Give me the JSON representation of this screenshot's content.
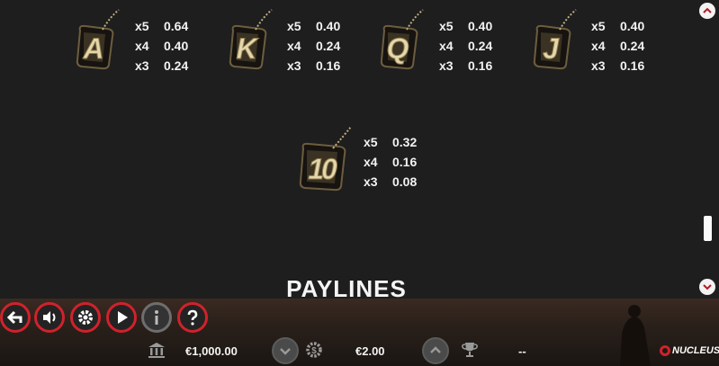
{
  "paytable": {
    "symbols": [
      {
        "letter": "A",
        "pays": [
          {
            "mult": "x5",
            "value": "0.64"
          },
          {
            "mult": "x4",
            "value": "0.40"
          },
          {
            "mult": "x3",
            "value": "0.24"
          }
        ]
      },
      {
        "letter": "K",
        "pays": [
          {
            "mult": "x5",
            "value": "0.40"
          },
          {
            "mult": "x4",
            "value": "0.24"
          },
          {
            "mult": "x3",
            "value": "0.16"
          }
        ]
      },
      {
        "letter": "Q",
        "pays": [
          {
            "mult": "x5",
            "value": "0.40"
          },
          {
            "mult": "x4",
            "value": "0.24"
          },
          {
            "mult": "x3",
            "value": "0.16"
          }
        ]
      },
      {
        "letter": "J",
        "pays": [
          {
            "mult": "x5",
            "value": "0.40"
          },
          {
            "mult": "x4",
            "value": "0.24"
          },
          {
            "mult": "x3",
            "value": "0.16"
          }
        ]
      },
      {
        "letter": "10",
        "pays": [
          {
            "mult": "x5",
            "value": "0.32"
          },
          {
            "mult": "x4",
            "value": "0.16"
          },
          {
            "mult": "x3",
            "value": "0.08"
          }
        ]
      }
    ],
    "section_title": "PAYLINES"
  },
  "controls": {
    "back_icon": "back-arrow-icon",
    "sound_icon": "speaker-icon",
    "settings_icon": "gear-icon",
    "autoplay_icon": "play-icon",
    "info_icon": "info-icon",
    "help_icon": "question-icon"
  },
  "status_bar": {
    "balance": "€1,000.00",
    "bet": "€2.00",
    "win": "--",
    "logo": "NUCLEUS"
  },
  "colors": {
    "accent": "#d0222c",
    "background": "#1e1e1e",
    "tag_gold": "#d8c79a"
  }
}
